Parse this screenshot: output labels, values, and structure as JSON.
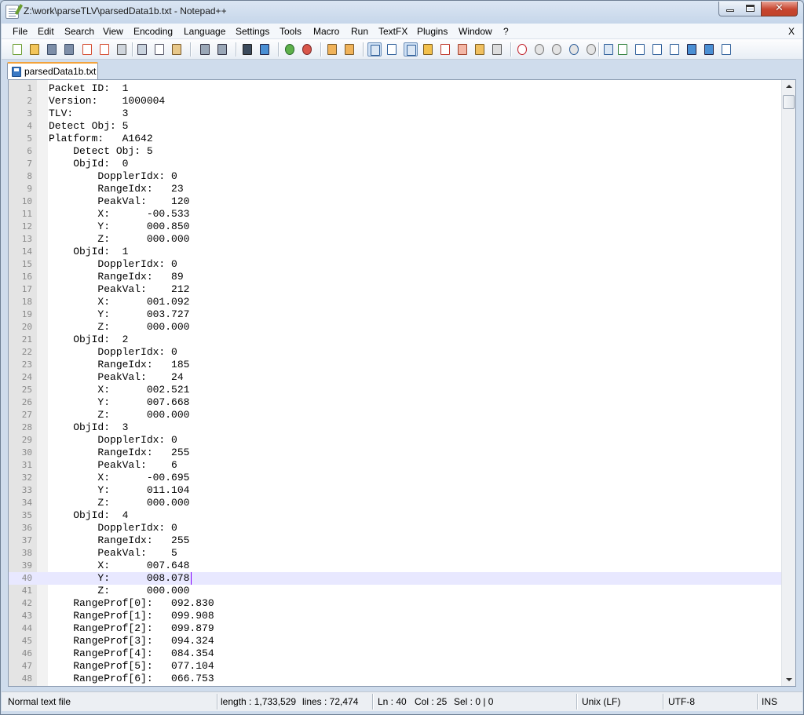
{
  "window": {
    "title": "Z:\\work\\parseTLV\\parsedData1b.txt - Notepad++"
  },
  "menu": {
    "items": [
      "File",
      "Edit",
      "Search",
      "View",
      "Encoding",
      "Language",
      "Settings",
      "Tools",
      "Macro",
      "Run",
      "TextFX",
      "Plugins",
      "Window",
      "?"
    ],
    "close": "X"
  },
  "toolbar": {
    "icons": [
      "new-file-icon",
      "open-file-icon",
      "save-icon",
      "save-all-icon",
      "close-file-icon",
      "close-all-icon",
      "print-icon",
      "cut-icon",
      "copy-icon",
      "paste-icon",
      "undo-icon",
      "redo-icon",
      "find-icon",
      "replace-icon",
      "zoom-in-icon",
      "zoom-out-icon",
      "sync-vertical-icon",
      "sync-horizontal-icon",
      "word-wrap-icon",
      "show-all-chars-icon",
      "indent-guide-icon",
      "user-lang-icon",
      "doc-map-icon",
      "function-list-icon",
      "folder-icon",
      "monitoring-icon",
      "record-macro-icon",
      "stop-macro-icon",
      "play-macro-icon",
      "run-macro-multiple-icon",
      "save-macro-icon",
      "plugin-a-icon",
      "plugin-b-icon",
      "plugin-c-icon",
      "plugin-d-icon",
      "plugin-e-icon",
      "plugin-f-icon",
      "plugin-g-icon",
      "plugin-h-icon"
    ]
  },
  "tab": {
    "label": "parsedData1b.txt"
  },
  "editor": {
    "current_line": 40,
    "lines": [
      "Packet ID:  1",
      "Version:    1000004",
      "TLV:        3",
      "Detect Obj: 5",
      "Platform:   A1642",
      "    Detect Obj: 5",
      "    ObjId:  0",
      "        DopplerIdx: 0",
      "        RangeIdx:   23",
      "        PeakVal:    120",
      "        X:      -00.533",
      "        Y:      000.850",
      "        Z:      000.000",
      "    ObjId:  1",
      "        DopplerIdx: 0",
      "        RangeIdx:   89",
      "        PeakVal:    212",
      "        X:      001.092",
      "        Y:      003.727",
      "        Z:      000.000",
      "    ObjId:  2",
      "        DopplerIdx: 0",
      "        RangeIdx:   185",
      "        PeakVal:    24",
      "        X:      002.521",
      "        Y:      007.668",
      "        Z:      000.000",
      "    ObjId:  3",
      "        DopplerIdx: 0",
      "        RangeIdx:   255",
      "        PeakVal:    6",
      "        X:      -00.695",
      "        Y:      011.104",
      "        Z:      000.000",
      "    ObjId:  4",
      "        DopplerIdx: 0",
      "        RangeIdx:   255",
      "        PeakVal:    5",
      "        X:      007.648",
      "        Y:      008.078",
      "        Z:      000.000",
      "    RangeProf[0]:   092.830",
      "    RangeProf[1]:   099.908",
      "    RangeProf[2]:   099.879",
      "    RangeProf[3]:   094.324",
      "    RangeProf[4]:   084.354",
      "    RangeProf[5]:   077.104",
      "    RangeProf[6]:   066.753"
    ]
  },
  "status": {
    "file_type": "Normal text file",
    "length": "length : 1,733,529",
    "lines": "lines : 72,474",
    "ln": "Ln : 40",
    "col": "Col : 25",
    "sel": "Sel : 0 | 0",
    "eol": "Unix (LF)",
    "encoding": "UTF-8",
    "mode": "INS"
  }
}
